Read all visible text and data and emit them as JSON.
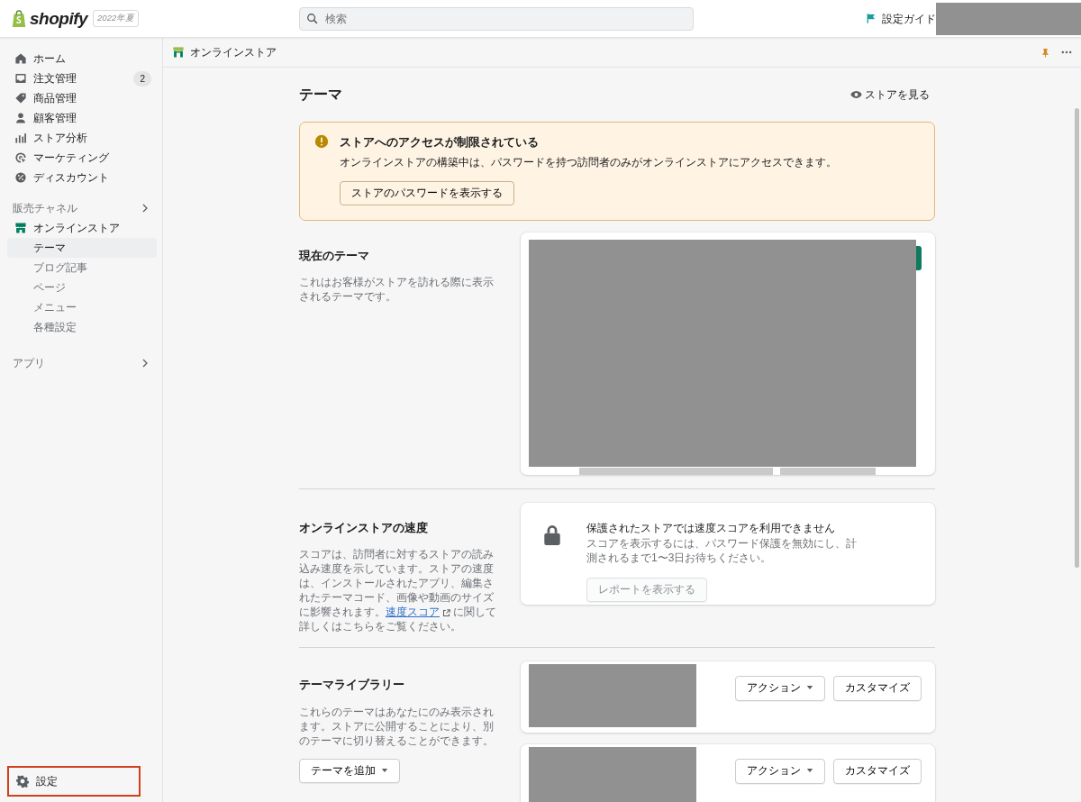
{
  "topbar": {
    "logo": "shopify",
    "edition_badge": "2022年夏",
    "search": {
      "placeholder": "検索"
    },
    "setup_guide": "設定ガイド"
  },
  "sidebar": {
    "items": [
      {
        "label": "ホーム",
        "selected": false
      },
      {
        "label": "注文管理",
        "selected": false,
        "badge": "2"
      },
      {
        "label": "商品管理",
        "selected": false
      },
      {
        "label": "顧客管理",
        "selected": false
      },
      {
        "label": "ストア分析",
        "selected": false
      },
      {
        "label": "マーケティング",
        "selected": false
      },
      {
        "label": "ディスカウント",
        "selected": false
      }
    ],
    "sections": [
      {
        "title": "販売チャネル",
        "items": [
          {
            "label": "オンラインストア",
            "children": [
              {
                "label": "テーマ",
                "selected": true
              },
              {
                "label": "ブログ記事",
                "selected": false
              },
              {
                "label": "ページ",
                "selected": false
              },
              {
                "label": "メニュー",
                "selected": false
              },
              {
                "label": "各種設定",
                "selected": false
              }
            ]
          }
        ]
      },
      {
        "title": "アプリ"
      }
    ],
    "settings": {
      "label": "設定",
      "highlighted": true
    }
  },
  "header": {
    "title": "オンラインストア"
  },
  "page": {
    "title": "テーマ",
    "view_store": "ストアを見る",
    "banner": {
      "title": "ストアへのアクセスが制限されている",
      "text": "オンラインストアの構築中は、パスワードを持つ訪問者のみがオンラインストアにアクセスできます。",
      "button": "ストアのパスワードを表示する"
    },
    "sections": [
      {
        "kind": "current",
        "title": "現在のテーマ",
        "description": "これはお客様がストアを訪れる際に表示されるテーマです。"
      },
      {
        "kind": "speed",
        "title": "オンラインストアの速度",
        "description_before": "スコアは、訪問者に対するストアの読み込み速度を示しています。ストアの速度は、インストールされたアプリ、編集されたテーマコード、画像や動画のサイズに影響されます。",
        "link": "速度スコア",
        "description_after": " に関して詳しくはこちらをご覧ください。",
        "notice": {
          "title": "保護されたストアでは速度スコアを利用できません",
          "text": "スコアを表示するには、パスワード保護を無効にし、計測されるまで1〜3日お待ちください。",
          "button": {
            "label": "レポートを表示する",
            "disabled": true
          }
        }
      },
      {
        "kind": "library",
        "title": "テーマライブラリー",
        "description": "これらのテーマはあなたにのみ表示されます。ストアに公開することにより、別のテーマに切り替えることができます。",
        "add_button": "テーマを追加",
        "themes": [
          {
            "actions_button": "アクション",
            "customize_button": "カスタマイズ"
          },
          {
            "actions_button": "アクション",
            "customize_button": "カスタマイズ"
          }
        ]
      }
    ]
  }
}
